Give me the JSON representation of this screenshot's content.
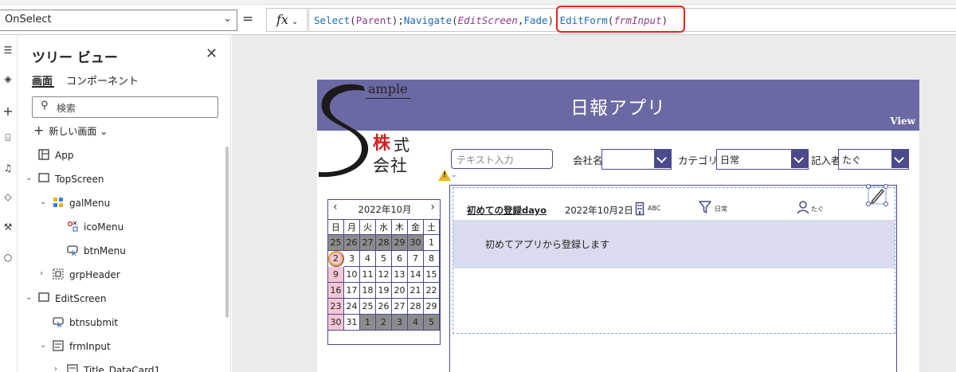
{
  "formula_bar": {
    "property": "OnSelect",
    "equals": "=",
    "fx_label": "fx",
    "formula_segments": [
      {
        "text": "Select",
        "cls": "f-fn"
      },
      {
        "text": "(",
        "cls": "f-pun"
      },
      {
        "text": "Parent",
        "cls": "f-id"
      },
      {
        "text": ");",
        "cls": "f-pun"
      },
      {
        "text": "Navigate",
        "cls": "f-fn"
      },
      {
        "text": "(",
        "cls": "f-pun"
      },
      {
        "text": "EditScreen",
        "cls": "f-it"
      },
      {
        "text": ",",
        "cls": "f-pun"
      },
      {
        "text": "Fade",
        "cls": "f-fn"
      },
      {
        "text": ");",
        "cls": "f-pun"
      },
      {
        "text": "EditForm",
        "cls": "f-fn"
      },
      {
        "text": "(",
        "cls": "f-pun"
      },
      {
        "text": "frmInput",
        "cls": "f-it"
      },
      {
        "text": ")",
        "cls": "f-pun"
      }
    ]
  },
  "tree_view": {
    "title": "ツリー ビュー",
    "tabs": [
      "画面",
      "コンポーネント"
    ],
    "search_placeholder": "検索",
    "new_screen_label": "新しい画面",
    "items": [
      {
        "label": "App",
        "icon": "app-icon",
        "level": 0,
        "toggle": ""
      },
      {
        "label": "TopScreen",
        "icon": "screen-icon",
        "level": 0,
        "toggle": "expanded"
      },
      {
        "label": "galMenu",
        "icon": "gallery-icon",
        "level": 1,
        "toggle": "expanded"
      },
      {
        "label": "icoMenu",
        "icon": "icon-control-icon",
        "level": 2,
        "toggle": ""
      },
      {
        "label": "btnMenu",
        "icon": "button-control-icon",
        "level": 2,
        "toggle": ""
      },
      {
        "label": "grpHeader",
        "icon": "group-icon",
        "level": 1,
        "toggle": "collapsed"
      },
      {
        "label": "EditScreen",
        "icon": "screen-icon",
        "level": 0,
        "toggle": "expanded"
      },
      {
        "label": "btnsubmit",
        "icon": "button-control-icon",
        "level": 1,
        "toggle": ""
      },
      {
        "label": "frmInput",
        "icon": "form-icon",
        "level": 1,
        "toggle": "expanded"
      },
      {
        "label": "Title_DataCard1",
        "icon": "card-icon",
        "level": 2,
        "toggle": "collapsed"
      }
    ]
  },
  "app": {
    "title": "日報アプリ",
    "view_label": "View",
    "logo": {
      "sample": "ample",
      "kabu": "株",
      "shiki": "式",
      "kaisha": "会社"
    },
    "search_placeholder": "テキスト入力",
    "filters": {
      "company_label": "会社名",
      "company_value": "",
      "category_label": "カテゴリ",
      "category_value": "日常",
      "person_label": "記入者",
      "person_value": "たぐ"
    },
    "calendar": {
      "month_label": "2022年10月",
      "weekdays": [
        "日",
        "月",
        "火",
        "水",
        "木",
        "金",
        "土"
      ],
      "weeks": [
        [
          "25",
          "26",
          "27",
          "28",
          "29",
          "30",
          "1"
        ],
        [
          "2",
          "3",
          "4",
          "5",
          "6",
          "7",
          "8"
        ],
        [
          "9",
          "10",
          "11",
          "12",
          "13",
          "14",
          "15"
        ],
        [
          "16",
          "17",
          "18",
          "19",
          "20",
          "21",
          "22"
        ],
        [
          "23",
          "24",
          "25",
          "26",
          "27",
          "28",
          "29"
        ],
        [
          "30",
          "31",
          "1",
          "2",
          "3",
          "4",
          "5"
        ]
      ],
      "colors": {
        "other_month": "#8c8c8c",
        "sunday": "#f4c7d6",
        "weekday": "#ffffff",
        "today_ring": "#f0a030"
      }
    },
    "record": {
      "title": "初めての登録dayo",
      "date": "2022年10月2日",
      "company": "ABC",
      "category": "日常",
      "person": "たぐ",
      "body": "初めてアプリから登録します"
    }
  },
  "colors": {
    "header": "#6b69a3",
    "accent": "#4b4a8c",
    "highlight": "#e8231b",
    "record_body": "#d9dcee"
  }
}
